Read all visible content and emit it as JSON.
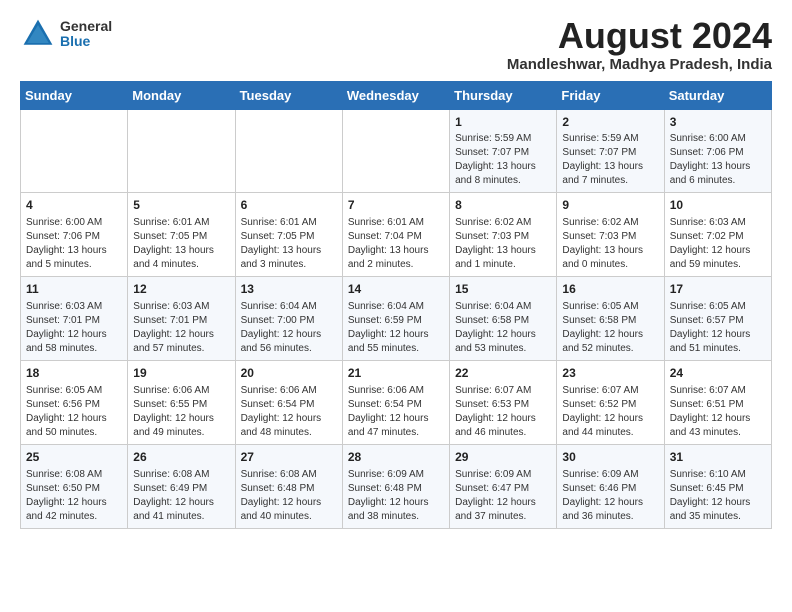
{
  "header": {
    "logo_general": "General",
    "logo_blue": "Blue",
    "month_year": "August 2024",
    "location": "Mandleshwar, Madhya Pradesh, India"
  },
  "days_of_week": [
    "Sunday",
    "Monday",
    "Tuesday",
    "Wednesday",
    "Thursday",
    "Friday",
    "Saturday"
  ],
  "weeks": [
    [
      {
        "day": "",
        "info": ""
      },
      {
        "day": "",
        "info": ""
      },
      {
        "day": "",
        "info": ""
      },
      {
        "day": "",
        "info": ""
      },
      {
        "day": "1",
        "info": "Sunrise: 5:59 AM\nSunset: 7:07 PM\nDaylight: 13 hours and 8 minutes."
      },
      {
        "day": "2",
        "info": "Sunrise: 5:59 AM\nSunset: 7:07 PM\nDaylight: 13 hours and 7 minutes."
      },
      {
        "day": "3",
        "info": "Sunrise: 6:00 AM\nSunset: 7:06 PM\nDaylight: 13 hours and 6 minutes."
      }
    ],
    [
      {
        "day": "4",
        "info": "Sunrise: 6:00 AM\nSunset: 7:06 PM\nDaylight: 13 hours and 5 minutes."
      },
      {
        "day": "5",
        "info": "Sunrise: 6:01 AM\nSunset: 7:05 PM\nDaylight: 13 hours and 4 minutes."
      },
      {
        "day": "6",
        "info": "Sunrise: 6:01 AM\nSunset: 7:05 PM\nDaylight: 13 hours and 3 minutes."
      },
      {
        "day": "7",
        "info": "Sunrise: 6:01 AM\nSunset: 7:04 PM\nDaylight: 13 hours and 2 minutes."
      },
      {
        "day": "8",
        "info": "Sunrise: 6:02 AM\nSunset: 7:03 PM\nDaylight: 13 hours and 1 minute."
      },
      {
        "day": "9",
        "info": "Sunrise: 6:02 AM\nSunset: 7:03 PM\nDaylight: 13 hours and 0 minutes."
      },
      {
        "day": "10",
        "info": "Sunrise: 6:03 AM\nSunset: 7:02 PM\nDaylight: 12 hours and 59 minutes."
      }
    ],
    [
      {
        "day": "11",
        "info": "Sunrise: 6:03 AM\nSunset: 7:01 PM\nDaylight: 12 hours and 58 minutes."
      },
      {
        "day": "12",
        "info": "Sunrise: 6:03 AM\nSunset: 7:01 PM\nDaylight: 12 hours and 57 minutes."
      },
      {
        "day": "13",
        "info": "Sunrise: 6:04 AM\nSunset: 7:00 PM\nDaylight: 12 hours and 56 minutes."
      },
      {
        "day": "14",
        "info": "Sunrise: 6:04 AM\nSunset: 6:59 PM\nDaylight: 12 hours and 55 minutes."
      },
      {
        "day": "15",
        "info": "Sunrise: 6:04 AM\nSunset: 6:58 PM\nDaylight: 12 hours and 53 minutes."
      },
      {
        "day": "16",
        "info": "Sunrise: 6:05 AM\nSunset: 6:58 PM\nDaylight: 12 hours and 52 minutes."
      },
      {
        "day": "17",
        "info": "Sunrise: 6:05 AM\nSunset: 6:57 PM\nDaylight: 12 hours and 51 minutes."
      }
    ],
    [
      {
        "day": "18",
        "info": "Sunrise: 6:05 AM\nSunset: 6:56 PM\nDaylight: 12 hours and 50 minutes."
      },
      {
        "day": "19",
        "info": "Sunrise: 6:06 AM\nSunset: 6:55 PM\nDaylight: 12 hours and 49 minutes."
      },
      {
        "day": "20",
        "info": "Sunrise: 6:06 AM\nSunset: 6:54 PM\nDaylight: 12 hours and 48 minutes."
      },
      {
        "day": "21",
        "info": "Sunrise: 6:06 AM\nSunset: 6:54 PM\nDaylight: 12 hours and 47 minutes."
      },
      {
        "day": "22",
        "info": "Sunrise: 6:07 AM\nSunset: 6:53 PM\nDaylight: 12 hours and 46 minutes."
      },
      {
        "day": "23",
        "info": "Sunrise: 6:07 AM\nSunset: 6:52 PM\nDaylight: 12 hours and 44 minutes."
      },
      {
        "day": "24",
        "info": "Sunrise: 6:07 AM\nSunset: 6:51 PM\nDaylight: 12 hours and 43 minutes."
      }
    ],
    [
      {
        "day": "25",
        "info": "Sunrise: 6:08 AM\nSunset: 6:50 PM\nDaylight: 12 hours and 42 minutes."
      },
      {
        "day": "26",
        "info": "Sunrise: 6:08 AM\nSunset: 6:49 PM\nDaylight: 12 hours and 41 minutes."
      },
      {
        "day": "27",
        "info": "Sunrise: 6:08 AM\nSunset: 6:48 PM\nDaylight: 12 hours and 40 minutes."
      },
      {
        "day": "28",
        "info": "Sunrise: 6:09 AM\nSunset: 6:48 PM\nDaylight: 12 hours and 38 minutes."
      },
      {
        "day": "29",
        "info": "Sunrise: 6:09 AM\nSunset: 6:47 PM\nDaylight: 12 hours and 37 minutes."
      },
      {
        "day": "30",
        "info": "Sunrise: 6:09 AM\nSunset: 6:46 PM\nDaylight: 12 hours and 36 minutes."
      },
      {
        "day": "31",
        "info": "Sunrise: 6:10 AM\nSunset: 6:45 PM\nDaylight: 12 hours and 35 minutes."
      }
    ]
  ]
}
